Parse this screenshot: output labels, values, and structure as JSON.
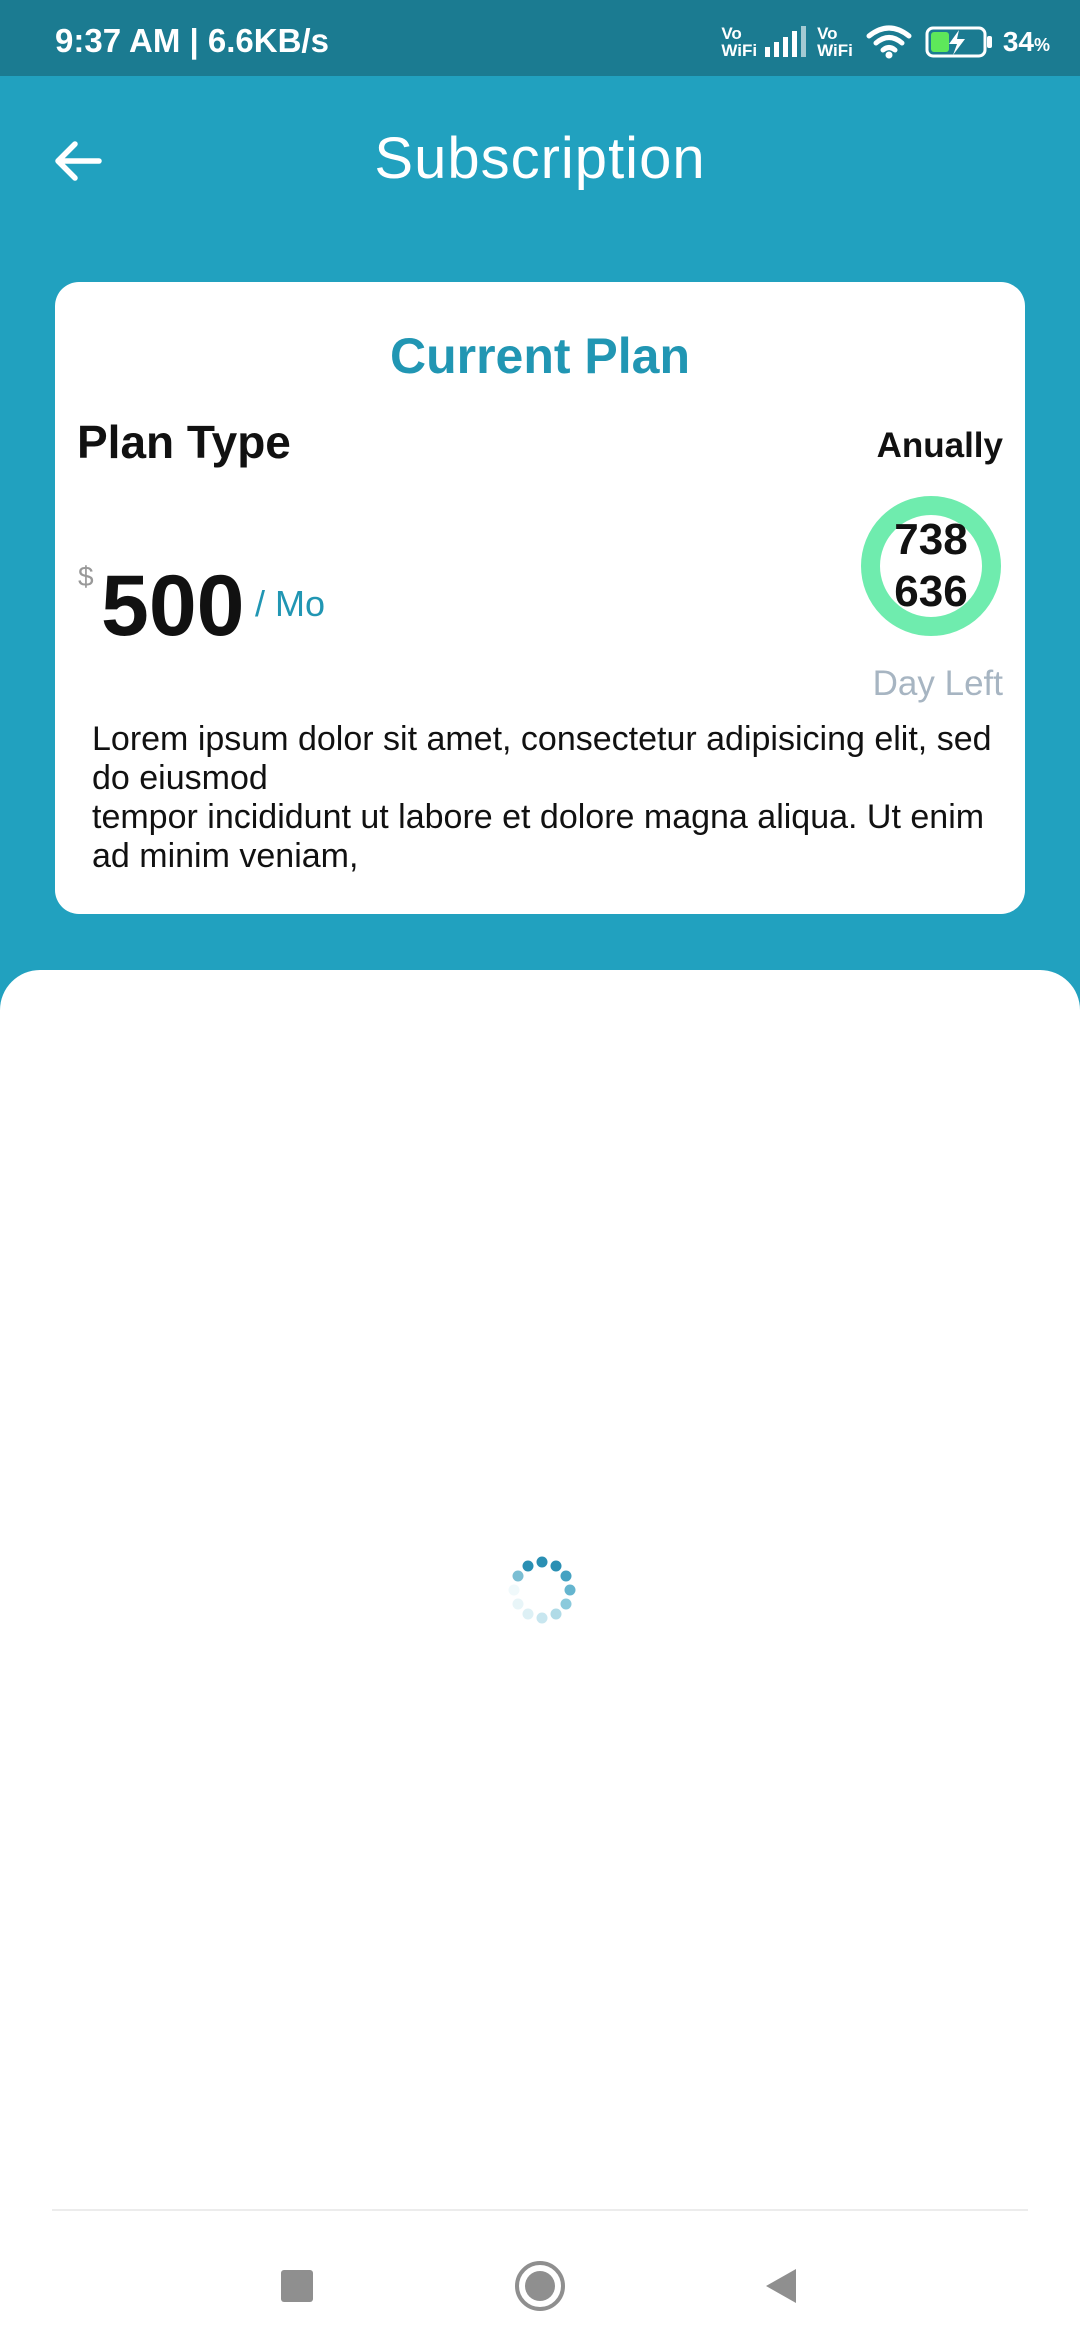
{
  "status_bar": {
    "time": "9:37 AM | 6.6KB/s",
    "vowifi_1_top": "Vo",
    "vowifi_1_bottom": "WiFi",
    "vowifi_2_top": "Vo",
    "vowifi_2_bottom": "WiFi",
    "battery_value": "34",
    "battery_unit": "%",
    "icons": [
      "signal-bars-icon",
      "wifi-icon",
      "battery-charging-icon"
    ]
  },
  "header": {
    "title": "Subscription",
    "back_icon": "arrow-left-icon"
  },
  "current_plan": {
    "title": "Current Plan",
    "plan_type_label": "Plan Type",
    "plan_period": "Anually",
    "currency": "$",
    "price": "500",
    "per_unit": "/ Mo",
    "days_remaining": "738636",
    "days_left_label": "Day Left",
    "description_line1": "Lorem ipsum dolor sit amet, consectetur adipisicing elit, sed do eiusmod",
    "description_line2": "tempor incididunt ut labore et dolore magna aliqua. Ut enim ad minim veniam,"
  },
  "colors": {
    "primary": "#21a1bf",
    "status_bar": "#1b7b91",
    "accent_text": "#2196b3",
    "ring": "#6fecae",
    "muted": "#a7b5c2"
  },
  "loading": {
    "icon": "loading-spinner-icon"
  },
  "nav_bar": {
    "icons": [
      "recent-apps-icon",
      "home-icon",
      "back-icon"
    ]
  }
}
